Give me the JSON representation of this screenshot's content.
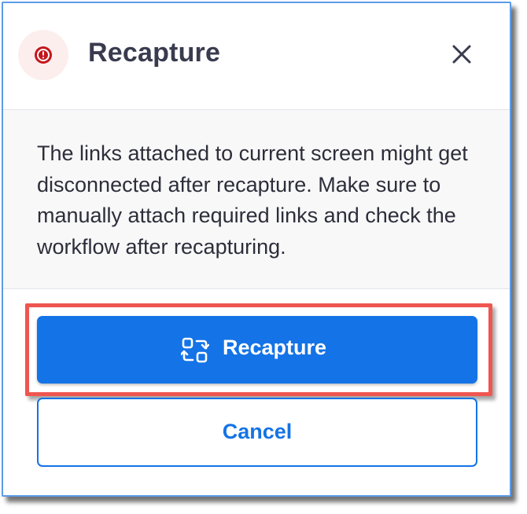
{
  "dialog": {
    "title": "Recapture",
    "message": "The links attached to current screen might get disconnected after recapture. Make sure to manually attach required links and check the workflow after recapturing.",
    "primary_button": {
      "label": "Recapture",
      "icon": "recapture-icon"
    },
    "secondary_button": {
      "label": "Cancel"
    },
    "header_icon": "warning-icon",
    "close_icon": "close-icon"
  },
  "colors": {
    "accent": "#1473e6",
    "danger": "#c4161c",
    "highlight_border": "#ef5650"
  }
}
